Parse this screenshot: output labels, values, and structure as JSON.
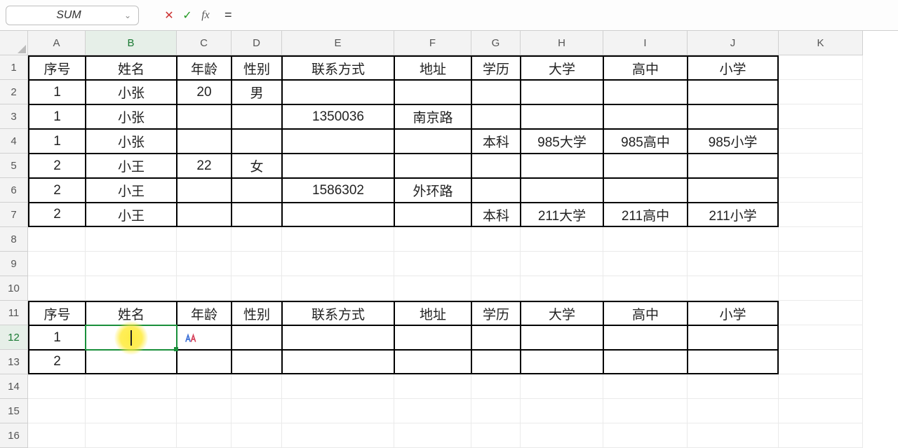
{
  "namebox": {
    "value": "SUM"
  },
  "formula_bar": {
    "cancel_glyph": "✕",
    "accept_glyph": "✓",
    "fx_label": "fx",
    "input_value": "="
  },
  "columns": [
    "A",
    "B",
    "C",
    "D",
    "E",
    "F",
    "G",
    "H",
    "I",
    "J",
    "K"
  ],
  "rows": [
    "1",
    "2",
    "3",
    "4",
    "5",
    "6",
    "7",
    "8",
    "9",
    "10",
    "11",
    "12",
    "13",
    "14",
    "15",
    "16"
  ],
  "headers1": {
    "A": "序号",
    "B": "姓名",
    "C": "年龄",
    "D": "性别",
    "E": "联系方式",
    "F": "地址",
    "G": "学历",
    "H": "大学",
    "I": "高中",
    "J": "小学"
  },
  "data": {
    "r2": {
      "A": "1",
      "B": "小张",
      "C": "20",
      "D": "男",
      "E": "",
      "F": "",
      "G": "",
      "H": "",
      "I": "",
      "J": ""
    },
    "r3": {
      "A": "1",
      "B": "小张",
      "C": "",
      "D": "",
      "E": "1350036",
      "F": "南京路",
      "G": "",
      "H": "",
      "I": "",
      "J": ""
    },
    "r4": {
      "A": "1",
      "B": "小张",
      "C": "",
      "D": "",
      "E": "",
      "F": "",
      "G": "本科",
      "H": "985大学",
      "I": "985高中",
      "J": "985小学"
    },
    "r5": {
      "A": "2",
      "B": "小王",
      "C": "22",
      "D": "女",
      "E": "",
      "F": "",
      "G": "",
      "H": "",
      "I": "",
      "J": ""
    },
    "r6": {
      "A": "2",
      "B": "小王",
      "C": "",
      "D": "",
      "E": "1586302",
      "F": "外环路",
      "G": "",
      "H": "",
      "I": "",
      "J": ""
    },
    "r7": {
      "A": "2",
      "B": "小王",
      "C": "",
      "D": "",
      "E": "",
      "F": "",
      "G": "本科",
      "H": "211大学",
      "I": "211高中",
      "J": "211小学"
    }
  },
  "headers2": {
    "A": "序号",
    "B": "姓名",
    "C": "年龄",
    "D": "性别",
    "E": "联系方式",
    "F": "地址",
    "G": "学历",
    "H": "大学",
    "I": "高中",
    "J": "小学"
  },
  "data2": {
    "r12": {
      "A": "1",
      "B": "",
      "C": "",
      "D": "",
      "E": "",
      "F": "",
      "G": "",
      "H": "",
      "I": "",
      "J": ""
    },
    "r13": {
      "A": "2",
      "B": "",
      "C": "",
      "D": "",
      "E": "",
      "F": "",
      "G": "",
      "H": "",
      "I": "",
      "J": ""
    }
  },
  "active_cell": {
    "row": "12",
    "col": "B"
  },
  "chart_data": {
    "type": "table",
    "tables": [
      {
        "name": "source",
        "columns": [
          "序号",
          "姓名",
          "年龄",
          "性别",
          "联系方式",
          "地址",
          "学历",
          "大学",
          "高中",
          "小学"
        ],
        "rows": [
          [
            "1",
            "小张",
            "20",
            "男",
            "",
            "",
            "",
            "",
            "",
            ""
          ],
          [
            "1",
            "小张",
            "",
            "",
            "1350036",
            "南京路",
            "",
            "",
            "",
            ""
          ],
          [
            "1",
            "小张",
            "",
            "",
            "",
            "",
            "本科",
            "985大学",
            "985高中",
            "985小学"
          ],
          [
            "2",
            "小王",
            "22",
            "女",
            "",
            "",
            "",
            "",
            "",
            ""
          ],
          [
            "2",
            "小王",
            "",
            "",
            "1586302",
            "外环路",
            "",
            "",
            "",
            ""
          ],
          [
            "2",
            "小王",
            "",
            "",
            "",
            "",
            "本科",
            "211大学",
            "211高中",
            "211小学"
          ]
        ]
      },
      {
        "name": "target",
        "columns": [
          "序号",
          "姓名",
          "年龄",
          "性别",
          "联系方式",
          "地址",
          "学历",
          "大学",
          "高中",
          "小学"
        ],
        "rows": [
          [
            "1",
            "",
            "",
            "",
            "",
            "",
            "",
            "",
            "",
            ""
          ],
          [
            "2",
            "",
            "",
            "",
            "",
            "",
            "",
            "",
            "",
            ""
          ]
        ]
      }
    ]
  }
}
